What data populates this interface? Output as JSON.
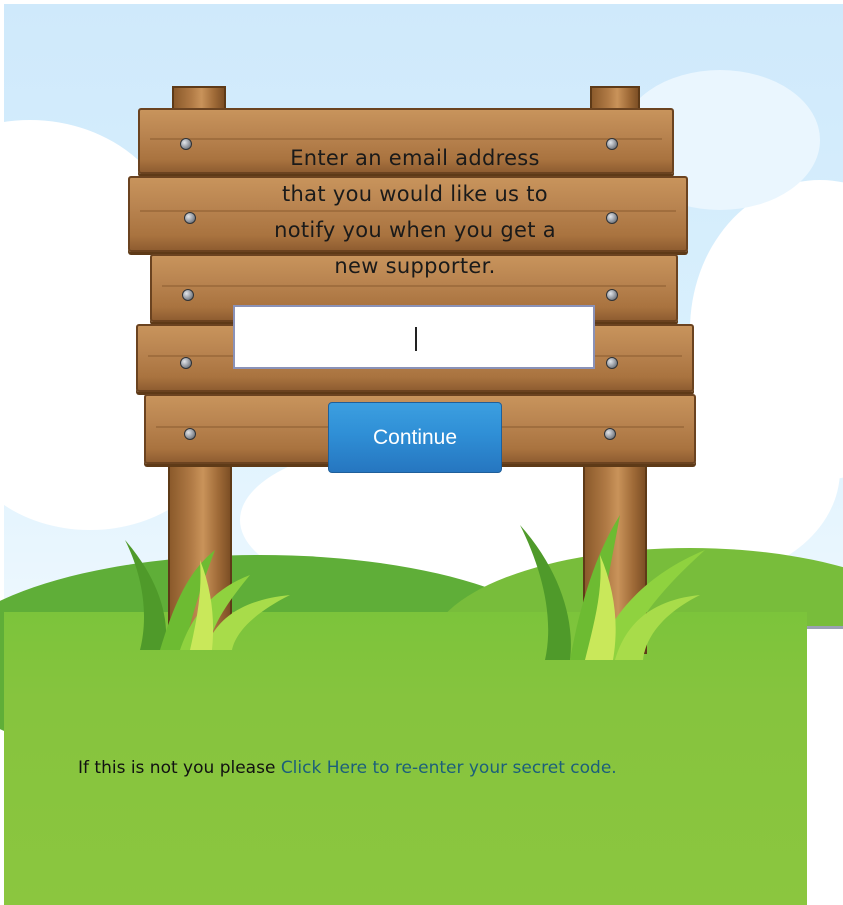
{
  "sign": {
    "lines": [
      "Enter an email address",
      "that you would like us to",
      "notify you when you get a",
      "new supporter."
    ]
  },
  "email_input": {
    "value": "",
    "placeholder": ""
  },
  "continue_button": {
    "label": "Continue"
  },
  "footer": {
    "prefix": "If this is not you please ",
    "link_text": "Click Here to re-enter your secret code."
  },
  "colors": {
    "sky": "#cfe9fb",
    "grass": "#8bc63f",
    "wood": "#b98450",
    "button": "#2f8fd6",
    "link": "#1c5f7a"
  },
  "icons": {
    "nails": "nail-icon",
    "grass_tufts": "grass-tuft-icon"
  }
}
